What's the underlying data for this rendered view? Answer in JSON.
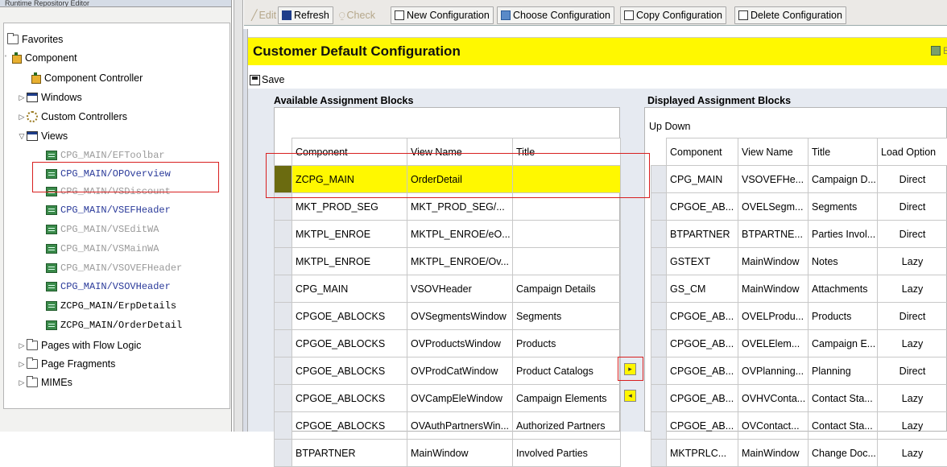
{
  "left_panel": {
    "title": "Runtime Repository Editor",
    "tree": [
      {
        "label": "Favorites",
        "icon": "folder-icon"
      },
      {
        "label": "Component",
        "icon": "component-icon"
      },
      {
        "label": "Component Controller",
        "icon": "component-controller-icon"
      },
      {
        "label": "Windows",
        "icon": "window-icon"
      },
      {
        "label": "Custom Controllers",
        "icon": "custom-controllers-icon"
      },
      {
        "label": "Views",
        "icon": "window-icon"
      },
      {
        "label": "CPG_MAIN/EFToolbar"
      },
      {
        "label": "CPG_MAIN/OPOverview"
      },
      {
        "label": "CPG_MAIN/VSDiscount"
      },
      {
        "label": "CPG_MAIN/VSEFHeader"
      },
      {
        "label": "CPG_MAIN/VSEditWA"
      },
      {
        "label": "CPG_MAIN/VSMainWA"
      },
      {
        "label": "CPG_MAIN/VSOVEFHeader"
      },
      {
        "label": "CPG_MAIN/VSOVHeader"
      },
      {
        "label": "ZCPG_MAIN/ErpDetails"
      },
      {
        "label": "ZCPG_MAIN/OrderDetail"
      },
      {
        "label": "Pages with Flow Logic",
        "icon": "folder-icon"
      },
      {
        "label": "Page Fragments",
        "icon": "folder-icon"
      },
      {
        "label": "MIMEs",
        "icon": "folder-icon"
      }
    ]
  },
  "toolbar": {
    "edit": "Edit",
    "refresh": "Refresh",
    "check": "Check",
    "new_config": "New Configuration",
    "choose_config": "Choose Configuration",
    "copy_config": "Copy Configuration",
    "delete_config": "Delete Configuration"
  },
  "header": {
    "title": "Customer Default Configuration",
    "back": "Ba"
  },
  "save_label": "Save",
  "available": {
    "title": "Available Assignment Blocks",
    "columns": [
      "Component",
      "View Name",
      "Title"
    ],
    "rows": [
      [
        "ZCPG_MAIN",
        "OrderDetail",
        ""
      ],
      [
        "MKT_PROD_SEG",
        "MKT_PROD_SEG/...",
        ""
      ],
      [
        "MKTPL_ENROE",
        "MKTPL_ENROE/eO...",
        ""
      ],
      [
        "MKTPL_ENROE",
        "MKTPL_ENROE/Ov...",
        ""
      ],
      [
        "CPG_MAIN",
        "VSOVHeader",
        "Campaign Details"
      ],
      [
        "CPGOE_ABLOCKS",
        "OVSegmentsWindow",
        "Segments"
      ],
      [
        "CPGOE_ABLOCKS",
        "OVProductsWindow",
        "Products"
      ],
      [
        "CPGOE_ABLOCKS",
        "OVProdCatWindow",
        "Product Catalogs"
      ],
      [
        "CPGOE_ABLOCKS",
        "OVCampEleWindow",
        "Campaign Elements"
      ],
      [
        "CPGOE_ABLOCKS",
        "OVAuthPartnersWin...",
        "Authorized Partners"
      ],
      [
        "BTPARTNER",
        "MainWindow",
        "Involved Parties"
      ]
    ]
  },
  "displayed": {
    "title": "Displayed Assignment Blocks",
    "up": "Up",
    "down": "Down",
    "columns": [
      "Component",
      "View Name",
      "Title",
      "Load Option"
    ],
    "rows": [
      [
        "CPG_MAIN",
        "VSOVEFHe...",
        "Campaign D...",
        "Direct"
      ],
      [
        "CPGOE_AB...",
        "OVELSegm...",
        "Segments",
        "Direct"
      ],
      [
        "BTPARTNER",
        "BTPARTNE...",
        "Parties Invol...",
        "Direct"
      ],
      [
        "GSTEXT",
        "MainWindow",
        "Notes",
        "Lazy"
      ],
      [
        "GS_CM",
        "MainWindow",
        "Attachments",
        "Lazy"
      ],
      [
        "CPGOE_AB...",
        "OVELProdu...",
        "Products",
        "Direct"
      ],
      [
        "CPGOE_AB...",
        "OVELElem...",
        "Campaign E...",
        "Lazy"
      ],
      [
        "CPGOE_AB...",
        "OVPlanning...",
        "Planning",
        "Direct"
      ],
      [
        "CPGOE_AB...",
        "OVHVConta...",
        "Contact Sta...",
        "Lazy"
      ],
      [
        "CPGOE_AB...",
        "OVContact...",
        "Contact Sta...",
        "Lazy"
      ],
      [
        "MKTPRLC...",
        "MainWindow",
        "Change Doc...",
        "Lazy"
      ]
    ]
  },
  "move_right": "▸",
  "move_left": "◂"
}
